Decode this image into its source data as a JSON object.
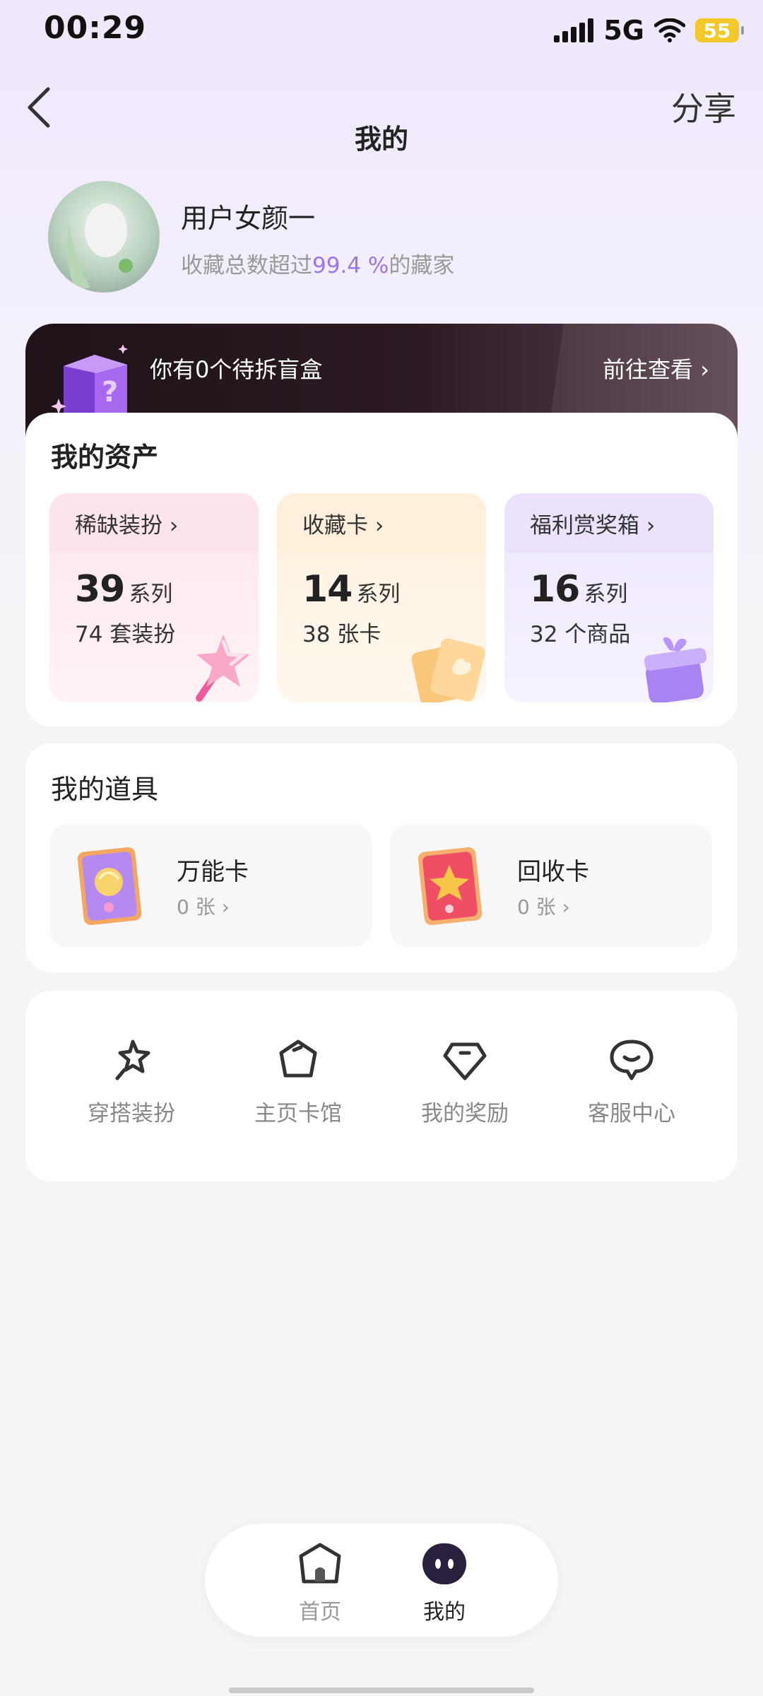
{
  "status": {
    "time": "00:29",
    "network": "5G",
    "battery": "55"
  },
  "header": {
    "title": "我的",
    "share_label": "分享"
  },
  "profile": {
    "name": "用户女颜一",
    "sub_prefix": "收藏总数超过",
    "percent": "99.4 %",
    "sub_suffix": "的藏家"
  },
  "banner": {
    "text": "你有0个待拆盲盒",
    "link_label": "前往查看 ›"
  },
  "assets": {
    "title": "我的资产",
    "tiles": [
      {
        "label": "稀缺装扮 ›",
        "count": "39",
        "unit": "系列",
        "sub": "74 套装扮"
      },
      {
        "label": "收藏卡 ›",
        "count": "14",
        "unit": "系列",
        "sub": "38 张卡"
      },
      {
        "label": "福利赏奖箱 ›",
        "count": "16",
        "unit": "系列",
        "sub": "32 个商品"
      }
    ]
  },
  "props": {
    "title": "我的道具",
    "items": [
      {
        "name": "万能卡",
        "count": "0 张 ›"
      },
      {
        "name": "回收卡",
        "count": "0 张 ›"
      }
    ]
  },
  "menu": {
    "items": [
      {
        "label": "穿搭装扮",
        "icon": "outfit-icon"
      },
      {
        "label": "主页卡馆",
        "icon": "card-hall-icon"
      },
      {
        "label": "我的奖励",
        "icon": "reward-icon"
      },
      {
        "label": "客服中心",
        "icon": "customer-service-icon"
      }
    ]
  },
  "nav": {
    "home_label": "首页",
    "mine_label": "我的"
  },
  "colors": {
    "accent": "#9b76e6",
    "banner_bg": "#1f1218",
    "battery": "#f2c928"
  }
}
